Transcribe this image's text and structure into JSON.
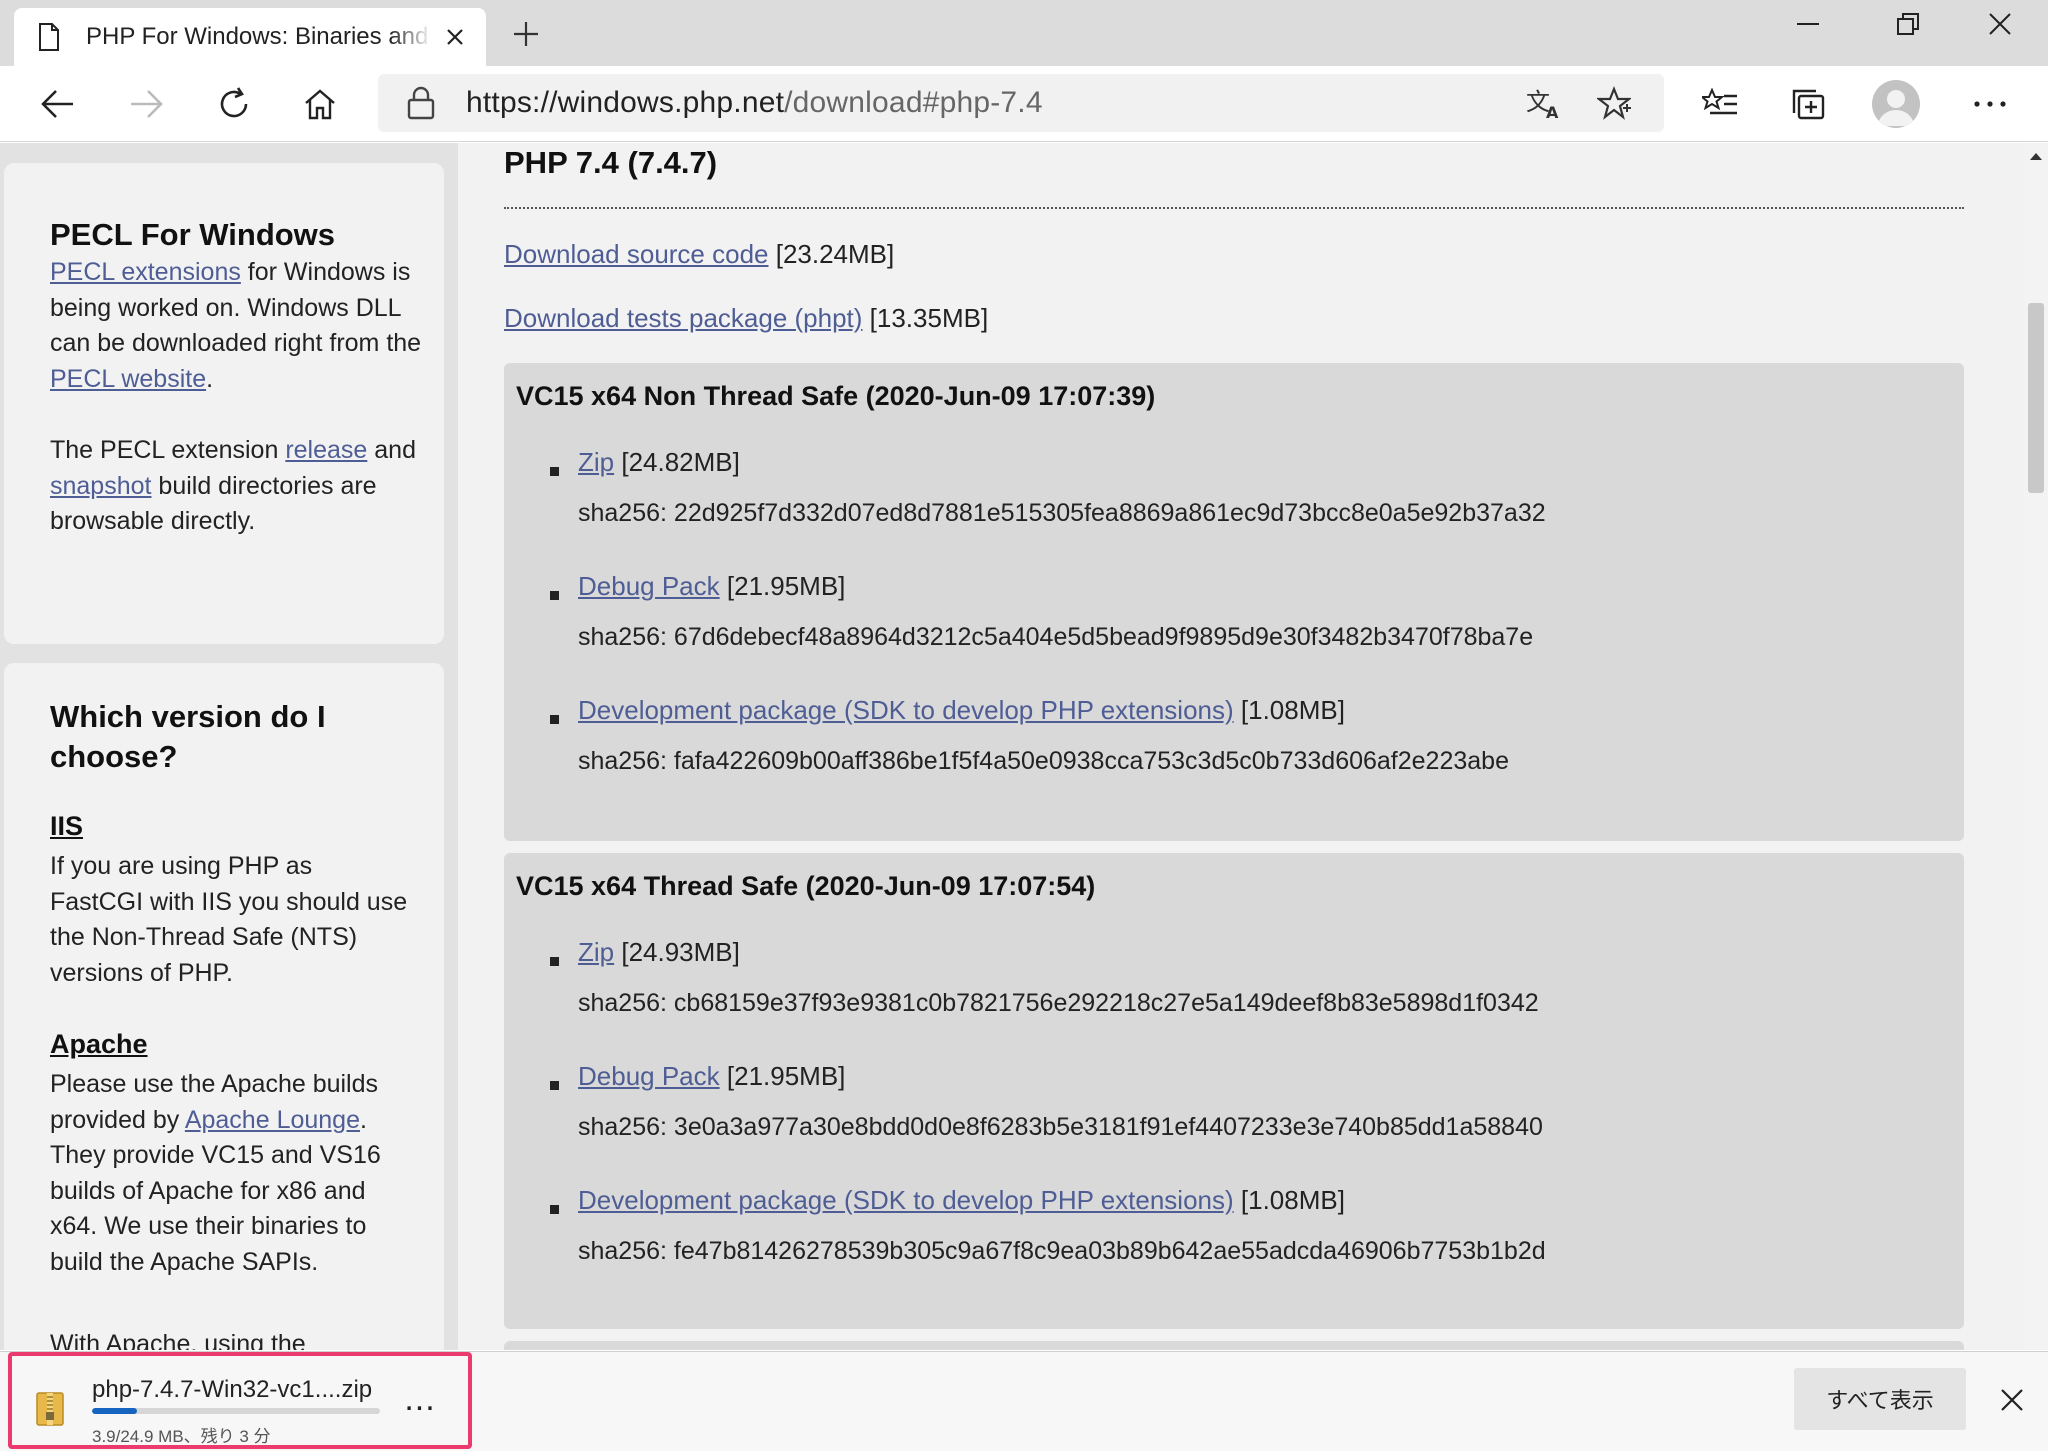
{
  "browser": {
    "tab_title": "PHP For Windows: Binaries and sources",
    "url_host": "https://windows.php.net",
    "url_path": "/download#php-7.4"
  },
  "sidebar": {
    "pecl": {
      "heading": "PECL For Windows",
      "link1": "PECL extensions",
      "text1": " for Windows is being worked on. Windows DLL can be downloaded right from the ",
      "link2": "PECL website",
      "text2": ".",
      "text3": "The PECL extension ",
      "link3": "release",
      "text4": " and ",
      "link4": "snapshot",
      "text5": " build directories are browsable directly."
    },
    "which": {
      "heading": "Which version do I choose?",
      "iis_heading": "IIS",
      "iis_text": "If you are using PHP as FastCGI with IIS you should use the Non-Thread Safe (NTS) versions of PHP.",
      "apache_heading": "Apache",
      "apache_text1": "Please use the Apache builds provided by ",
      "apache_link": "Apache Lounge",
      "apache_text2": ". They provide VC15 and VS16 builds of Apache for x86 and x64. We use their binaries to build the Apache SAPIs.",
      "apache_text3": "With Apache, using the"
    }
  },
  "main": {
    "heading": "PHP 7.4 (7.4.7)",
    "source": {
      "label": "Download source code",
      "size": " [23.24MB]"
    },
    "tests": {
      "label": "Download tests package (phpt)",
      "size": " [13.35MB]"
    },
    "builds": [
      {
        "title": "VC15 x64 Non Thread Safe (2020-Jun-09 17:07:39)",
        "items": [
          {
            "label": "Zip",
            "size": " [24.82MB]",
            "sha": "sha256: 22d925f7d332d07ed8d7881e515305fea8869a861ec9d73bcc8e0a5e92b37a32"
          },
          {
            "label": "Debug Pack",
            "size": " [21.95MB]",
            "sha": "sha256: 67d6debecf48a8964d3212c5a404e5d5bead9f9895d9e30f3482b3470f78ba7e"
          },
          {
            "label": "Development package (SDK to develop PHP extensions)",
            "size": " [1.08MB]",
            "sha": "sha256: fafa422609b00aff386be1f5f4a50e0938cca753c3d5c0b733d606af2e223abe"
          }
        ]
      },
      {
        "title": "VC15 x64 Thread Safe (2020-Jun-09 17:07:54)",
        "items": [
          {
            "label": "Zip",
            "size": " [24.93MB]",
            "sha": "sha256: cb68159e37f93e9381c0b7821756e292218c27e5a149deef8b83e5898d1f0342"
          },
          {
            "label": "Debug Pack",
            "size": " [21.95MB]",
            "sha": "sha256: 3e0a3a977a30e8bdd0d0e8f6283b5e3181f91ef4407233e3e740b85dd1a58840"
          },
          {
            "label": "Development package (SDK to develop PHP extensions)",
            "size": " [1.08MB]",
            "sha": "sha256: fe47b81426278539b305c9a67f8c9ea03b89b642ae55adcda46906b7753b1b2d"
          }
        ]
      }
    ]
  },
  "download_shelf": {
    "filename": "php-7.4.7-Win32-vc1....zip",
    "status": "3.9/24.9 MB、残り 3 分",
    "progress_fraction": 0.157,
    "more_label": "...",
    "show_all": "すべて表示"
  },
  "colors": {
    "link": "#4f5d95",
    "highlight_border": "#ea3a6e",
    "progress": "#1565c0"
  }
}
